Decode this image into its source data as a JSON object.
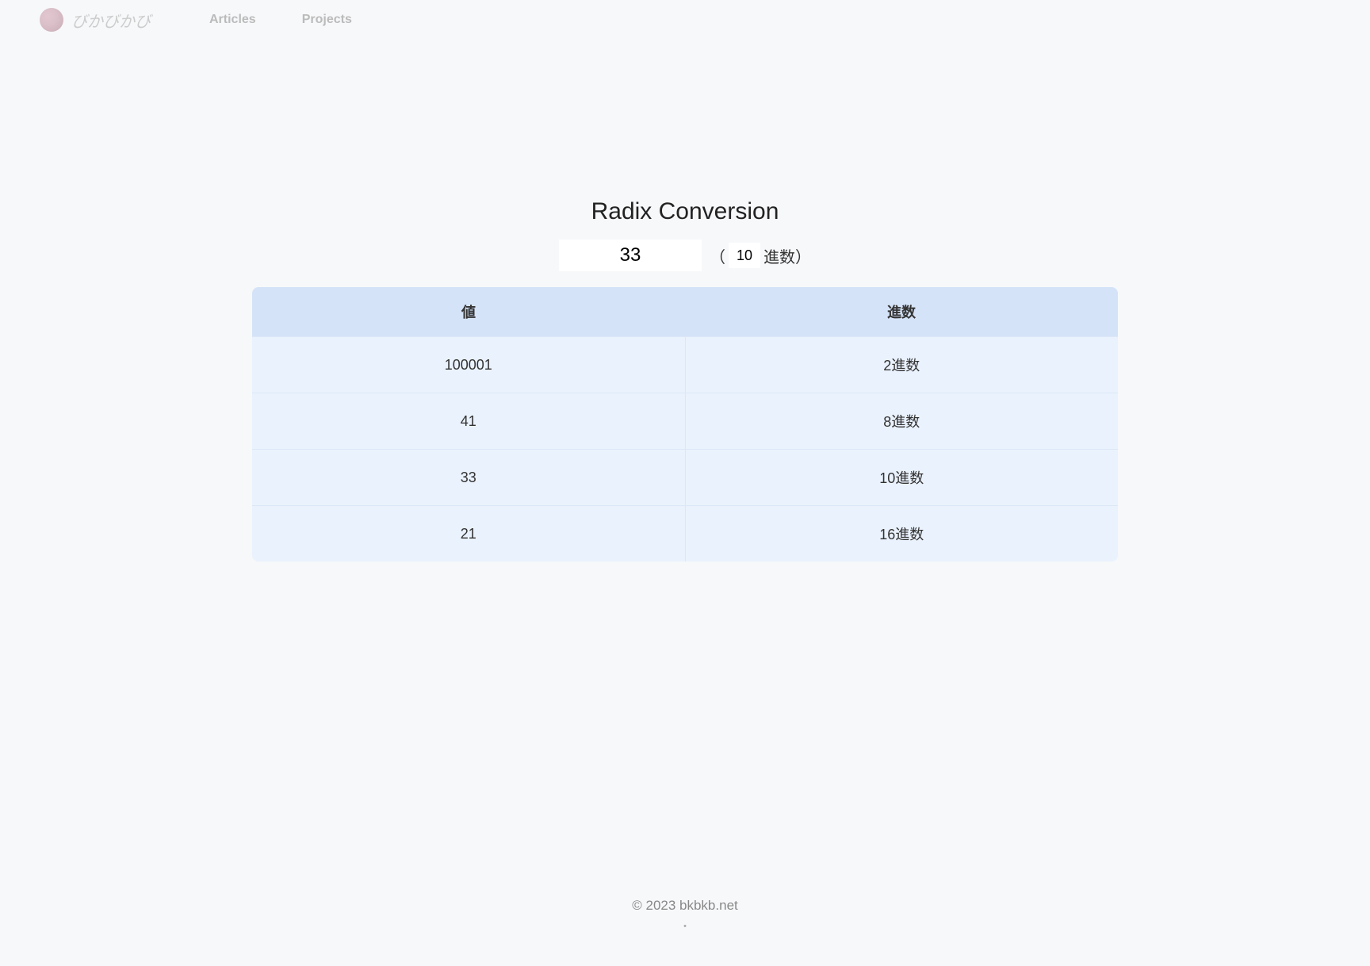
{
  "nav": {
    "site_title": "びかびかび",
    "links": [
      {
        "label": "Articles"
      },
      {
        "label": "Projects"
      }
    ]
  },
  "page": {
    "title": "Radix Conversion",
    "value_input": "33",
    "radix_paren_open": "（",
    "radix_input": "10",
    "radix_suffix": "進数）"
  },
  "table": {
    "headers": {
      "value": "値",
      "radix": "進数"
    },
    "rows": [
      {
        "value": "100001",
        "radix": "2進数"
      },
      {
        "value": "41",
        "radix": "8進数"
      },
      {
        "value": "33",
        "radix": "10進数"
      },
      {
        "value": "21",
        "radix": "16進数"
      }
    ]
  },
  "footer": {
    "copyright": "© 2023 bkbkb.net",
    "dot": "・"
  }
}
